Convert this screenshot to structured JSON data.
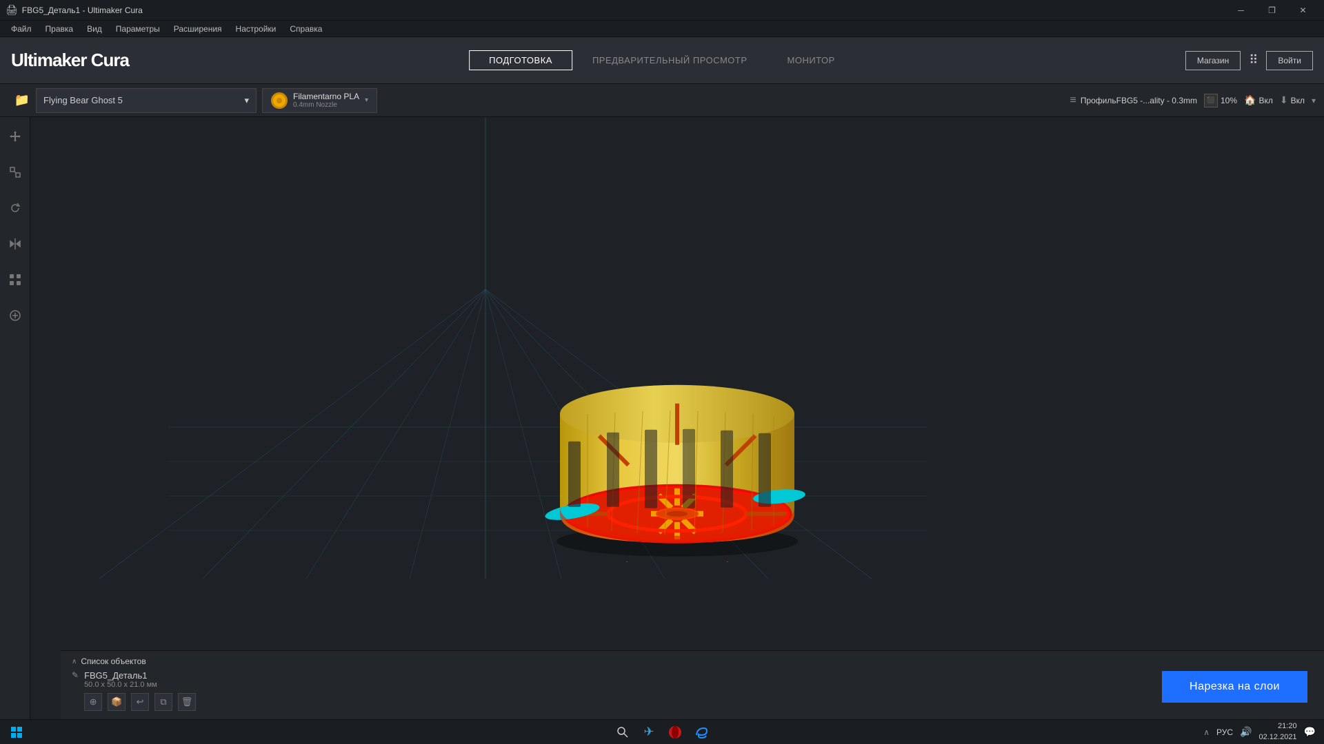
{
  "window": {
    "title": "FBG5_Деталь1 - Ultimaker Cura",
    "icon": "🖨"
  },
  "titlebar": {
    "title": "FBG5_Деталь1 - Ultimaker Cura",
    "minimize": "─",
    "restore": "❐",
    "close": "✕"
  },
  "menubar": {
    "items": [
      "Файл",
      "Правка",
      "Вид",
      "Параметры",
      "Расширения",
      "Настройки",
      "Справка"
    ]
  },
  "header": {
    "logo_light": "Ultimaker",
    "logo_bold": " Cura",
    "tabs": [
      {
        "label": "ПОДГОТОВКА",
        "active": true
      },
      {
        "label": "ПРЕДВАРИТЕЛЬНЫЙ ПРОСМОТР",
        "active": false
      },
      {
        "label": "МОНИТОР",
        "active": false
      }
    ],
    "shop_label": "Магазин",
    "sign_in_label": "Войти"
  },
  "printer_bar": {
    "printer_name": "Flying Bear Ghost 5",
    "filament_name": "Filamentarno PLA",
    "nozzle": "0.4mm Nozzle",
    "profile_label": "ПрофильFBG5 -...ality - 0.3mm",
    "toggle1_label": "10%",
    "toggle2_label": "Вкл",
    "toggle3_label": "Вкл"
  },
  "viewport": {
    "bg_color": "#1e2227"
  },
  "object_panel": {
    "list_header": "Список объектов",
    "object_name": "FBG5_Деталь1",
    "object_dims": "50.0 x 50.0 x 21.0 мм",
    "action_icons": [
      "⊕",
      "📦",
      "↩",
      "⧉",
      "🗑"
    ]
  },
  "slice_button": {
    "label": "Нарезка на слои"
  },
  "taskbar": {
    "start_icon": "⊞",
    "search_icon": "🔍",
    "telegram_icon": "✈",
    "opera_icon": "O",
    "edge_icon": "e",
    "language": "РУС",
    "time": "21:20",
    "date": "02.12.2021"
  },
  "icons": {
    "folder": "📁",
    "move": "✛",
    "scale": "⊡",
    "rotate": "↺",
    "mirror": "⇔",
    "arrange": "⊞",
    "support": "⚙",
    "profile": "≡",
    "chevron_down": "▾",
    "collapse": "∧",
    "edit": "✎"
  }
}
